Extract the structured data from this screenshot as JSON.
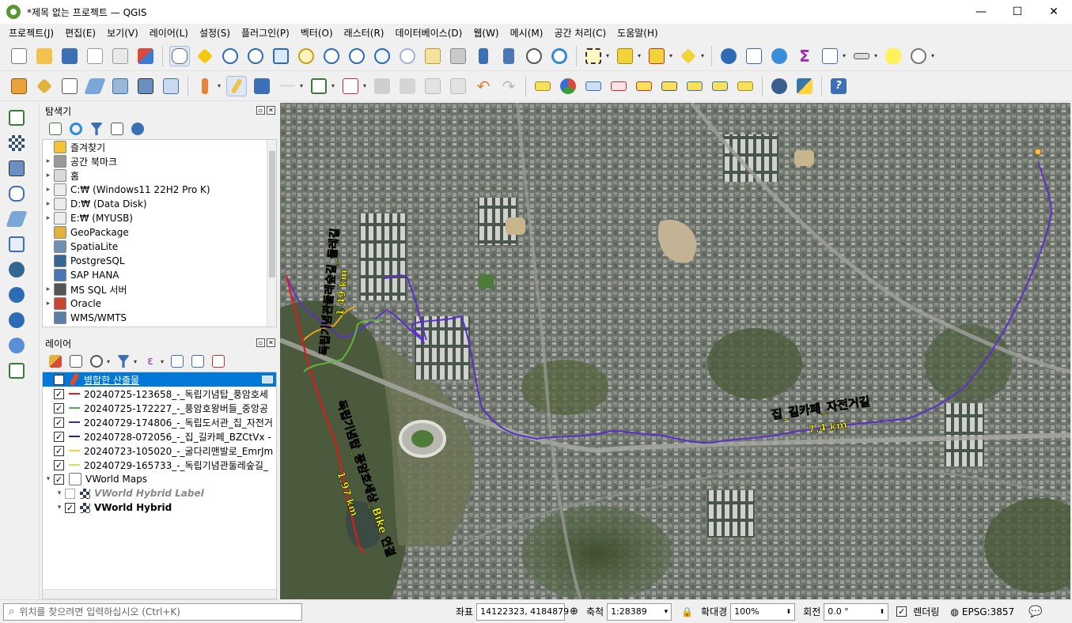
{
  "window": {
    "title": "*제목 없는 프로젝트 — QGIS",
    "minimize": "—",
    "maximize": "☐",
    "close": "✕"
  },
  "menu": [
    "프로젝트(J)",
    "편집(E)",
    "보기(V)",
    "레이어(L)",
    "설정(S)",
    "플러그인(P)",
    "벡터(O)",
    "래스터(R)",
    "데이터베이스(D)",
    "웹(W)",
    "메시(M)",
    "공간 처리(C)",
    "도움말(H)"
  ],
  "browser": {
    "title": "탐색기",
    "items": [
      {
        "label": "즐겨찾기",
        "icon": "star-icon",
        "expandable": false,
        "color": "#f4c430"
      },
      {
        "label": "공간 북마크",
        "icon": "bookmark-icon",
        "expandable": true,
        "color": "#9a9a9a"
      },
      {
        "label": "홈",
        "icon": "home-folder-icon",
        "expandable": true,
        "color": "#d9d9d9"
      },
      {
        "label": "C:₩ (Windows11 22H2 Pro K)",
        "icon": "folder-icon",
        "expandable": true,
        "color": "#ececec"
      },
      {
        "label": "D:₩ (Data Disk)",
        "icon": "folder-icon",
        "expandable": true,
        "color": "#ececec"
      },
      {
        "label": "E:₩ (MYUSB)",
        "icon": "folder-icon",
        "expandable": true,
        "color": "#ececec"
      },
      {
        "label": "GeoPackage",
        "icon": "geopackage-icon",
        "expandable": false,
        "color": "#e2b33b"
      },
      {
        "label": "SpatiaLite",
        "icon": "spatialite-icon",
        "expandable": false,
        "color": "#6f8fb5"
      },
      {
        "label": "PostgreSQL",
        "icon": "postgresql-icon",
        "expandable": false,
        "color": "#336791"
      },
      {
        "label": "SAP HANA",
        "icon": "sap-hana-icon",
        "expandable": false,
        "color": "#4a78b5"
      },
      {
        "label": "MS SQL 서버",
        "icon": "mssql-icon",
        "expandable": true,
        "color": "#555555"
      },
      {
        "label": "Oracle",
        "icon": "oracle-icon",
        "expandable": true,
        "color": "#c74634"
      },
      {
        "label": "WMS/WMTS",
        "icon": "wms-icon",
        "expandable": false,
        "color": "#5b7fa6"
      }
    ]
  },
  "layers": {
    "title": "레이어",
    "items": [
      {
        "label": "병합한 산출물",
        "checked": true,
        "color": "#e04a2a",
        "selected": true,
        "indent": 0
      },
      {
        "label": "20240725-123658_-_독립기념탑_풍암호세",
        "checked": true,
        "color": "#e41a1c",
        "indent": 0
      },
      {
        "label": "20240725-172227_-_풍암호왕버들_중앙공",
        "checked": true,
        "color": "#4caf50",
        "indent": 0
      },
      {
        "label": "20240729-174806_-_독립도서관_집_자전거",
        "checked": true,
        "color": "#3b2fb5",
        "indent": 0
      },
      {
        "label": "20240728-072056_-_집_길카페_BZCtVx -",
        "checked": true,
        "color": "#1d2a8c",
        "indent": 0
      },
      {
        "label": "20240723-105020_-_굴다리맨발로_EmrJm",
        "checked": true,
        "color": "#f2d33a",
        "indent": 0
      },
      {
        "label": "20240729-165733_-_독립기념관둘레숲길_",
        "checked": true,
        "color": "#e8d84a",
        "indent": 0
      },
      {
        "label": "VWorld Maps",
        "checked": true,
        "group": true,
        "indent": 0
      },
      {
        "label": "VWorld Hybrid Label",
        "checked": false,
        "italic": true,
        "indent": 1
      },
      {
        "label": "VWorld Hybrid",
        "checked": true,
        "bold": true,
        "indent": 1
      }
    ]
  },
  "map": {
    "labels": {
      "route1": "독립기념관둘레숲길_둘레길",
      "route1_dist": "1.49 km",
      "route2": "독립기념탑_풍암호세상_Bike 연결",
      "route2_dist": "1.97 km",
      "route3": "집_길카페_자전거길",
      "route3_dist": "7.4 km"
    },
    "colors": {
      "purple": "#5b2fc9",
      "red": "#e8161b",
      "green": "#62b43c",
      "orange": "#e8a21a",
      "label_yellow": "#ffff00"
    }
  },
  "status": {
    "locator_placeholder": "위치를 찾으려면 입력하십시오 (Ctrl+K)",
    "coord_label": "좌표",
    "coord": "14122323, 4184879",
    "scale_label": "축척",
    "scale": "1:28389",
    "magnifier_label": "확대경",
    "magnifier": "100%",
    "rotation_label": "회전",
    "rotation": "0.0 °",
    "render_label": "렌더링",
    "crs": "EPSG:3857"
  }
}
